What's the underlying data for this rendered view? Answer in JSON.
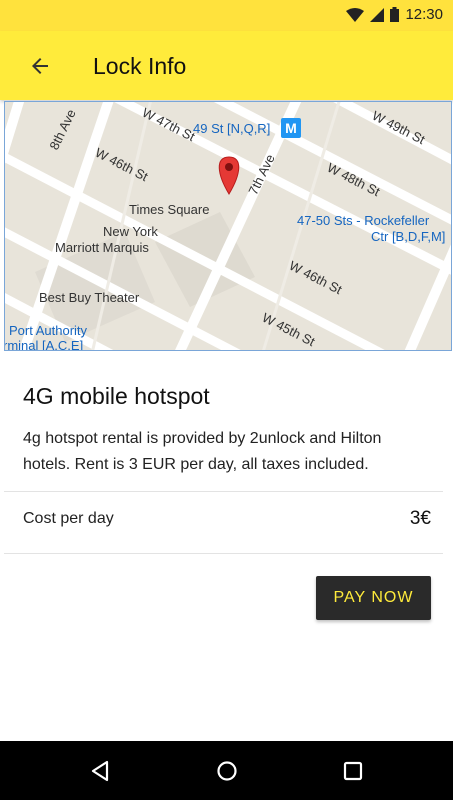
{
  "status_bar": {
    "time": "12:30",
    "icons": [
      "wifi-icon",
      "signal-icon",
      "battery-icon"
    ]
  },
  "app_bar": {
    "title": "Lock Info",
    "back_icon": "arrow-left-icon"
  },
  "map": {
    "labels": {
      "st47": "W 47th St",
      "st46a": "W 46th St",
      "ave8": "8th Ave",
      "ave7": "7th Ave",
      "st49": "W 49th St",
      "st48": "W 48th St",
      "st46b": "W 46th St",
      "st45": "W 45th St",
      "subway1": "49 St [N,Q,R]",
      "subway2_l1": "47-50 Sts - Rockefeller",
      "subway2_l2": "Ctr [B,D,F,M]",
      "times_square": "Times Square",
      "marriott_l1": "New York",
      "marriott_l2": "Marriott Marquis",
      "best_buy": "Best Buy Theater",
      "port_l1": "Port Authority",
      "port_l2": "rminal [A,C,E]",
      "metro_badge": "M"
    },
    "pin_icon": "map-pin-icon"
  },
  "card": {
    "title": "4G mobile hotspot",
    "description": "4g hotspot rental is provided by 2unlock and Hilton hotels. Rent is 3 EUR per day, all taxes included.",
    "cost_label": "Cost per day",
    "cost_value": "3€",
    "pay_button": "PAY NOW"
  },
  "nav_bar": {
    "icons": [
      "back-triangle-icon",
      "home-circle-icon",
      "recents-square-icon"
    ]
  },
  "colors": {
    "accent": "#ffeb3b",
    "status": "#ffe23d",
    "button": "#2a2a2a"
  }
}
